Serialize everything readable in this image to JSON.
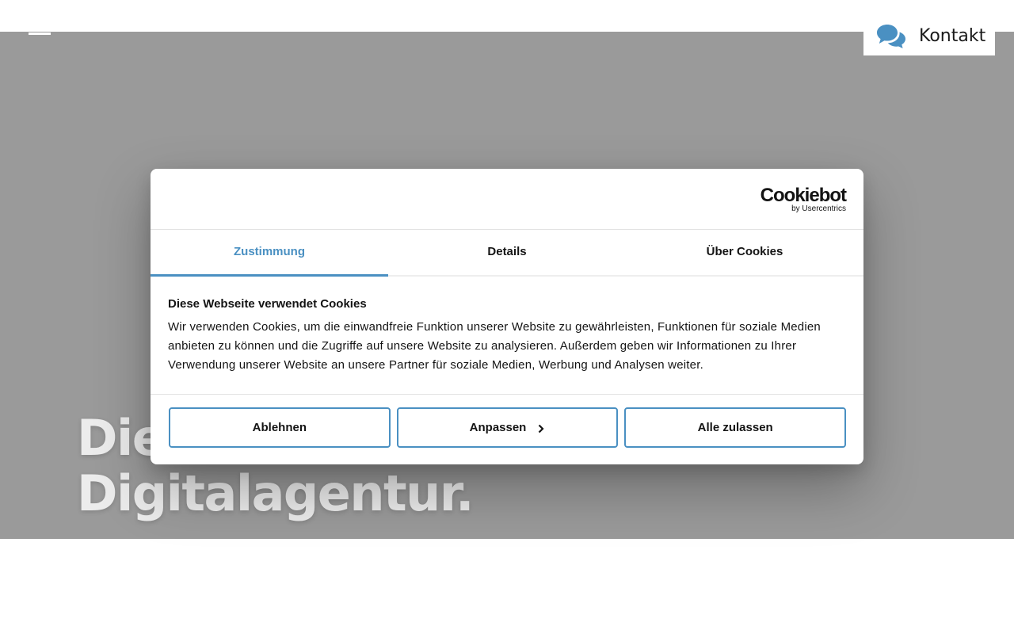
{
  "header": {
    "menu_icon": "hamburger-icon",
    "contact_label": "Kontakt",
    "contact_icon": "chat-bubbles-icon",
    "accent_color": "#4a90c2"
  },
  "hero": {
    "title_line1": "Die",
    "title_line2": "Digitalagentur."
  },
  "cookie_dialog": {
    "logo_brand": "Cookiebot",
    "logo_byline": "by Usercentrics",
    "tabs": [
      {
        "label": "Zustimmung",
        "active": true
      },
      {
        "label": "Details",
        "active": false
      },
      {
        "label": "Über Cookies",
        "active": false
      }
    ],
    "title": "Diese Webseite verwendet Cookies",
    "text": "Wir verwenden Cookies, um die einwandfreie Funktion unserer Website zu gewährleisten, Funktionen für soziale Medien anbieten zu können und die Zugriffe auf unsere Website zu analysieren. Außerdem geben wir Informationen zu Ihrer Verwendung unserer Website an unsere Partner für soziale Medien, Werbung und Analysen weiter.",
    "buttons": {
      "decline": "Ablehnen",
      "customize": "Anpassen",
      "accept_all": "Alle zulassen"
    }
  }
}
